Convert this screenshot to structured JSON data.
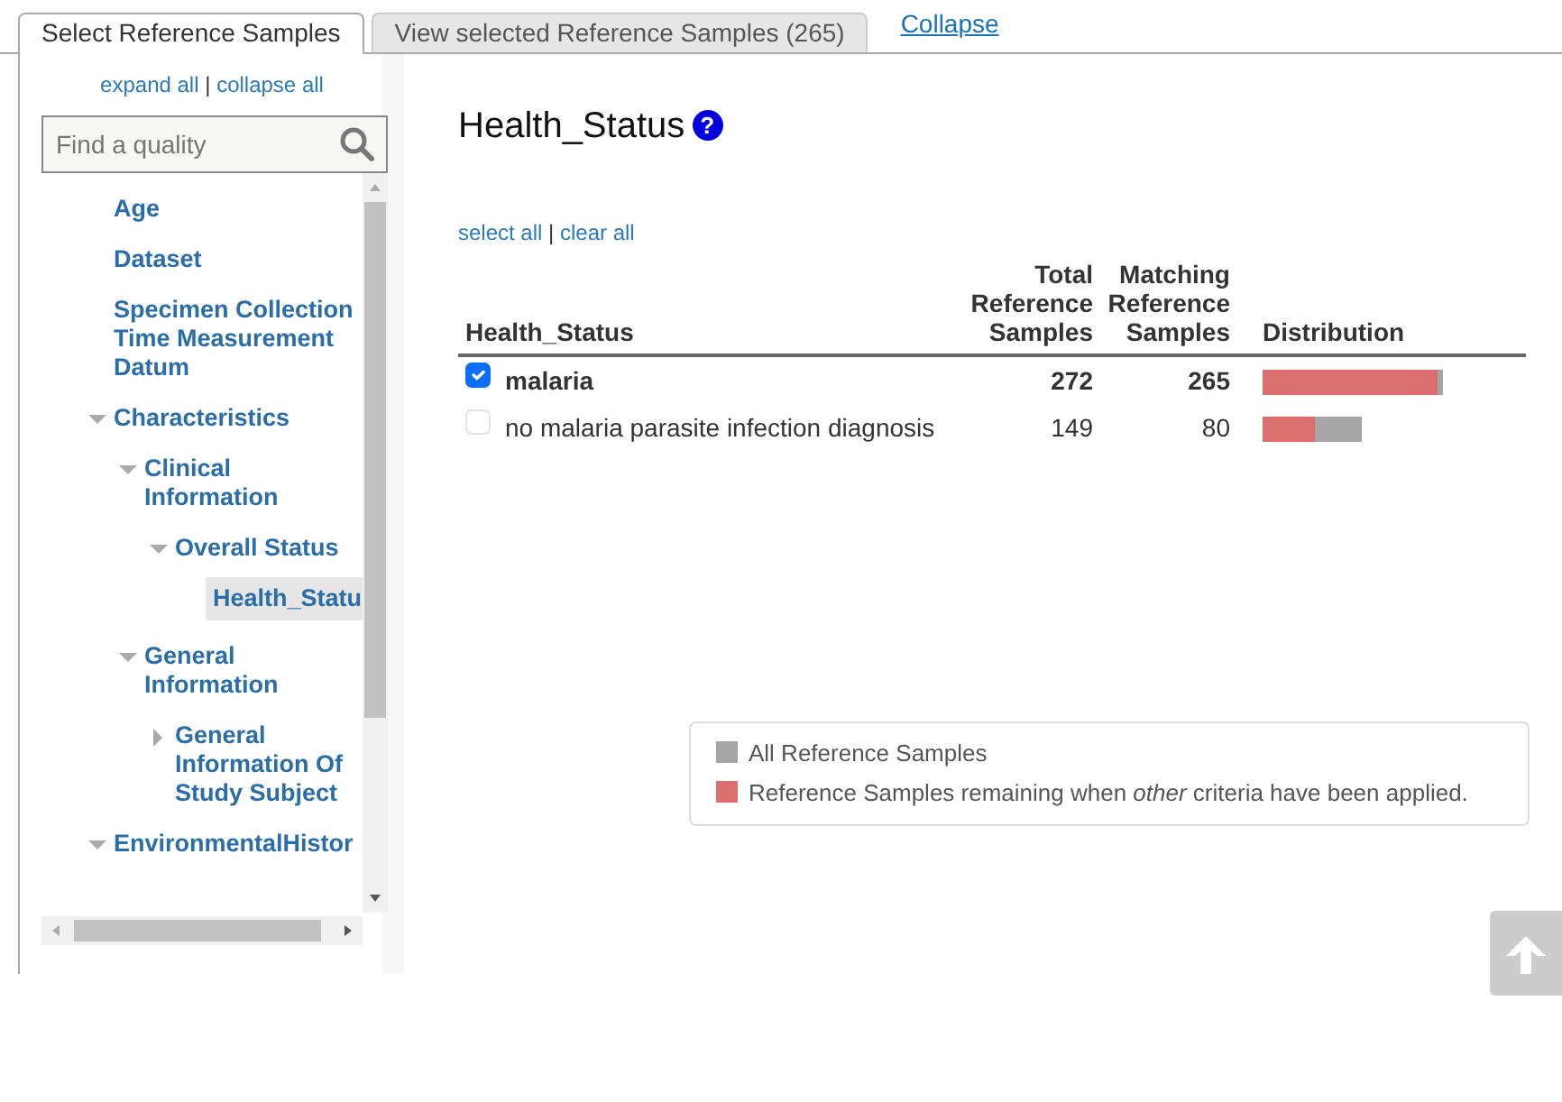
{
  "tabs": [
    {
      "label": "Select Reference Samples",
      "selected": true
    },
    {
      "label": "View selected Reference Samples (265)",
      "selected": false
    }
  ],
  "collapse_link": "Collapse",
  "sidebar": {
    "expand_all": "expand all",
    "separator": "|",
    "collapse_all": "collapse all",
    "search": {
      "placeholder": "Find a quality"
    },
    "tree": [
      {
        "label": "Age"
      },
      {
        "label": "Dataset"
      },
      {
        "label": "Specimen Collection Time Measurement Datum"
      },
      {
        "label": "Characteristics",
        "expanded": true,
        "children": [
          {
            "label": "Clinical Information",
            "expanded": true,
            "children": [
              {
                "label": "Overall Status",
                "expanded": true,
                "children": [
                  {
                    "label": "Health_Statu",
                    "selected": true
                  }
                ]
              }
            ]
          },
          {
            "label": "General Information",
            "expanded": true,
            "children": [
              {
                "label": "General Information Of Study Subject",
                "expanded": false
              }
            ]
          }
        ]
      },
      {
        "label": "EnvironmentalHistor",
        "expanded": true
      }
    ]
  },
  "main": {
    "title": "Health_Status",
    "help_icon": "?",
    "select_all": "select all",
    "separator": "|",
    "clear_all": "clear all",
    "table": {
      "columns": [
        "Health_Status",
        "Total Reference Samples",
        "Matching Reference Samples",
        "Distribution"
      ],
      "rows": [
        {
          "checked": true,
          "label": "malaria",
          "total": "272",
          "matching": "265",
          "distribution": {
            "total": {
              "level": 1
            },
            "matching": {
              "level": 0.974
            }
          }
        },
        {
          "checked": false,
          "label": "no malaria parasite infection diagnosis",
          "total": "149",
          "matching": "80",
          "distribution": {
            "total": {
              "level": 0.548
            },
            "matching": {
              "level": 0.537
            }
          }
        }
      ]
    },
    "legend": [
      {
        "text": "All Reference Samples",
        "color": "#a6a6a6"
      },
      {
        "text": "Reference Samples remaining when *other* criteria have been applied.",
        "color": "#d9706f"
      }
    ]
  }
}
